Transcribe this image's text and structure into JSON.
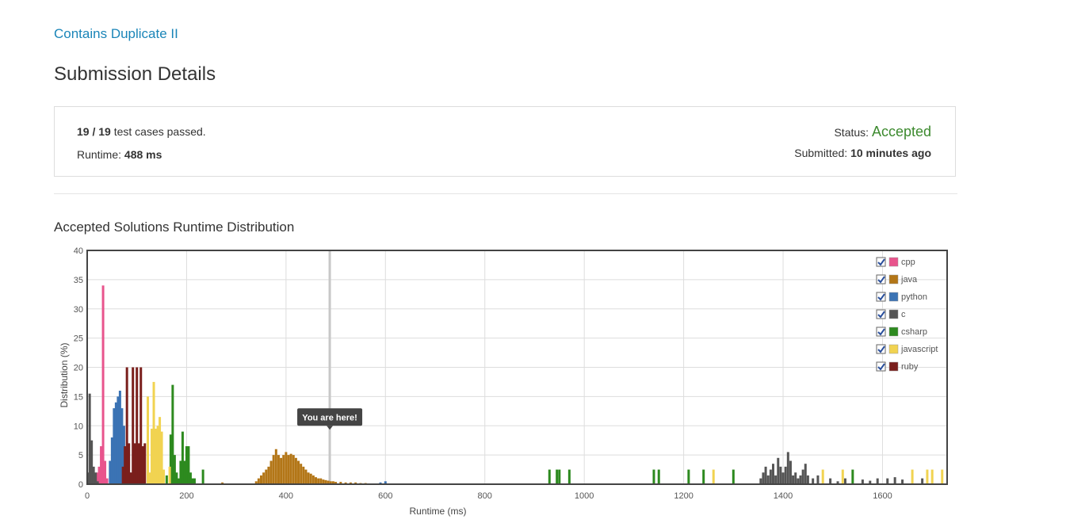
{
  "problem": {
    "title": "Contains Duplicate II"
  },
  "page": {
    "title": "Submission Details"
  },
  "summary": {
    "passed": "19",
    "sep": " / ",
    "total": "19",
    "passed_suffix": " test cases passed.",
    "runtime_label": "Runtime: ",
    "runtime_value": "488 ms",
    "status_label": "Status: ",
    "status_value": "Accepted",
    "submitted_label": "Submitted: ",
    "submitted_value": "10 minutes ago"
  },
  "section": {
    "title": "Accepted Solutions Runtime Distribution"
  },
  "chart_data": {
    "type": "bar",
    "xlabel": "Runtime (ms)",
    "ylabel": "Distribution (%)",
    "xlim": [
      0,
      1730
    ],
    "ylim": [
      0,
      40
    ],
    "xticks": [
      0,
      200,
      400,
      600,
      800,
      1000,
      1200,
      1400,
      1600
    ],
    "yticks": [
      0,
      5,
      10,
      15,
      20,
      25,
      30,
      35,
      40
    ],
    "grid": true,
    "legend_position": "top-right",
    "marker": {
      "label": "You are here!",
      "x": 488
    },
    "series": [
      {
        "name": "cpp",
        "color": "#e8548c",
        "checked": true,
        "points": [
          [
            20,
            2
          ],
          [
            24,
            3
          ],
          [
            28,
            6.5
          ],
          [
            32,
            34
          ],
          [
            36,
            4
          ],
          [
            40,
            1
          ]
        ]
      },
      {
        "name": "java",
        "color": "#b37617",
        "checked": true,
        "points": [
          [
            272,
            0.3
          ],
          [
            340,
            0.5
          ],
          [
            345,
            1
          ],
          [
            350,
            1.5
          ],
          [
            355,
            2
          ],
          [
            360,
            2.5
          ],
          [
            365,
            3
          ],
          [
            370,
            4
          ],
          [
            375,
            5
          ],
          [
            380,
            6
          ],
          [
            385,
            5
          ],
          [
            390,
            4.5
          ],
          [
            395,
            5
          ],
          [
            400,
            5.5
          ],
          [
            405,
            5
          ],
          [
            410,
            5.2
          ],
          [
            415,
            5
          ],
          [
            420,
            4.5
          ],
          [
            425,
            4
          ],
          [
            430,
            3.5
          ],
          [
            435,
            3
          ],
          [
            440,
            2.5
          ],
          [
            445,
            2
          ],
          [
            450,
            1.8
          ],
          [
            455,
            1.5
          ],
          [
            460,
            1.2
          ],
          [
            465,
            1
          ],
          [
            470,
            1
          ],
          [
            475,
            0.8
          ],
          [
            480,
            0.7
          ],
          [
            485,
            0.6
          ],
          [
            490,
            0.5
          ],
          [
            495,
            0.5
          ],
          [
            500,
            0.4
          ],
          [
            510,
            0.4
          ],
          [
            520,
            0.3
          ],
          [
            530,
            0.3
          ],
          [
            540,
            0.3
          ],
          [
            550,
            0.2
          ],
          [
            560,
            0.2
          ]
        ]
      },
      {
        "name": "python",
        "color": "#3b73b4",
        "checked": true,
        "points": [
          [
            46,
            4
          ],
          [
            50,
            8
          ],
          [
            54,
            13
          ],
          [
            58,
            14
          ],
          [
            62,
            15
          ],
          [
            66,
            16
          ],
          [
            70,
            13
          ],
          [
            74,
            10
          ],
          [
            78,
            6
          ],
          [
            82,
            3
          ],
          [
            86,
            2
          ],
          [
            90,
            1
          ],
          [
            590,
            0.3
          ],
          [
            600,
            0.5
          ]
        ]
      },
      {
        "name": "c",
        "color": "#555555",
        "checked": true,
        "points": [
          [
            2,
            2
          ],
          [
            5,
            15.5
          ],
          [
            9,
            7.5
          ],
          [
            13,
            3
          ],
          [
            17,
            2
          ],
          [
            21,
            0.5
          ],
          [
            1355,
            1
          ],
          [
            1360,
            2
          ],
          [
            1365,
            3
          ],
          [
            1370,
            1.5
          ],
          [
            1375,
            2.5
          ],
          [
            1380,
            3.5
          ],
          [
            1385,
            1.5
          ],
          [
            1390,
            4.5
          ],
          [
            1395,
            3
          ],
          [
            1400,
            2
          ],
          [
            1405,
            3
          ],
          [
            1410,
            5.5
          ],
          [
            1415,
            4
          ],
          [
            1420,
            1.5
          ],
          [
            1425,
            2
          ],
          [
            1430,
            1
          ],
          [
            1435,
            1.5
          ],
          [
            1440,
            2.5
          ],
          [
            1445,
            3.5
          ],
          [
            1450,
            1.5
          ],
          [
            1460,
            1
          ],
          [
            1470,
            1.5
          ],
          [
            1495,
            1
          ],
          [
            1510,
            0.5
          ],
          [
            1525,
            1
          ],
          [
            1560,
            0.8
          ],
          [
            1575,
            0.6
          ],
          [
            1590,
            1
          ],
          [
            1610,
            1
          ],
          [
            1625,
            1.2
          ],
          [
            1640,
            0.8
          ],
          [
            1680,
            1
          ]
        ]
      },
      {
        "name": "csharp",
        "color": "#2d8a1f",
        "checked": true,
        "points": [
          [
            160,
            1.5
          ],
          [
            168,
            8.5
          ],
          [
            172,
            17
          ],
          [
            176,
            5
          ],
          [
            180,
            2
          ],
          [
            184,
            1
          ],
          [
            188,
            4
          ],
          [
            192,
            9
          ],
          [
            196,
            4
          ],
          [
            200,
            6.5
          ],
          [
            204,
            6.5
          ],
          [
            208,
            2
          ],
          [
            212,
            1
          ],
          [
            216,
            1
          ],
          [
            233,
            2.5
          ],
          [
            930,
            2.5
          ],
          [
            945,
            2.5
          ],
          [
            950,
            2.5
          ],
          [
            970,
            2.5
          ],
          [
            1140,
            2.5
          ],
          [
            1150,
            2.5
          ],
          [
            1210,
            2.5
          ],
          [
            1240,
            2.5
          ],
          [
            1300,
            2.5
          ],
          [
            1540,
            2.5
          ]
        ]
      },
      {
        "name": "javascript",
        "color": "#f1d351",
        "checked": true,
        "points": [
          [
            122,
            15
          ],
          [
            126,
            2
          ],
          [
            130,
            9.5
          ],
          [
            134,
            17.5
          ],
          [
            138,
            9.5
          ],
          [
            142,
            10
          ],
          [
            146,
            11.5
          ],
          [
            150,
            9
          ],
          [
            154,
            2.5
          ],
          [
            166,
            3
          ],
          [
            1260,
            2.5
          ],
          [
            1480,
            2.5
          ],
          [
            1520,
            2.5
          ],
          [
            1660,
            2.5
          ],
          [
            1690,
            2.5
          ],
          [
            1700,
            2.5
          ],
          [
            1720,
            2.5
          ]
        ]
      },
      {
        "name": "ruby",
        "color": "#7a1f1c",
        "checked": true,
        "points": [
          [
            72,
            3
          ],
          [
            76,
            6.5
          ],
          [
            80,
            20
          ],
          [
            84,
            7
          ],
          [
            88,
            2
          ],
          [
            92,
            20
          ],
          [
            96,
            7
          ],
          [
            100,
            20
          ],
          [
            104,
            7
          ],
          [
            108,
            20
          ],
          [
            112,
            6.5
          ],
          [
            116,
            7
          ]
        ]
      }
    ]
  }
}
